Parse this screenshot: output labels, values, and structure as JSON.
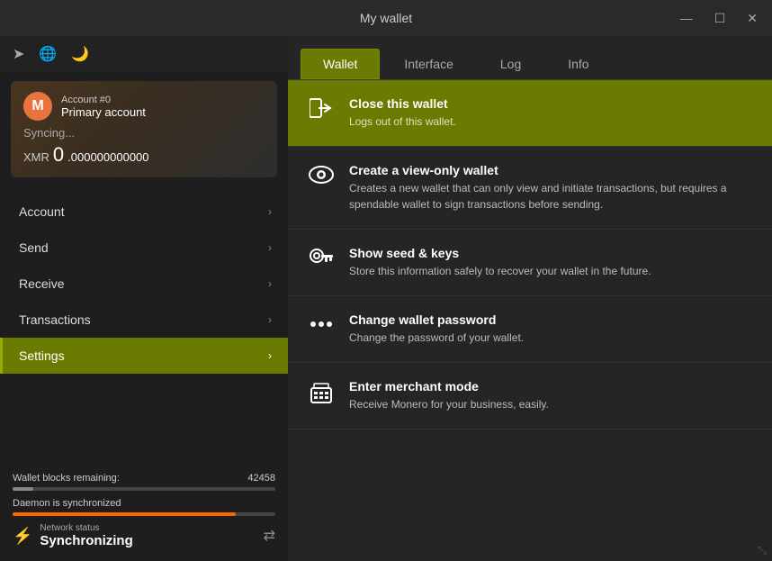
{
  "window": {
    "title": "My wallet",
    "minimize_label": "—",
    "maximize_label": "☐",
    "close_label": "✕"
  },
  "sidebar": {
    "icons": {
      "forward": "➤",
      "globe": "🌐",
      "moon": "🌙"
    },
    "account": {
      "number": "Account #0",
      "name": "Primary account",
      "syncing": "Syncing...",
      "currency": "XMR",
      "balance_whole": "0",
      "balance_decimal": ".000000000000",
      "logo_letter": "M"
    },
    "nav": [
      {
        "id": "account",
        "label": "Account",
        "active": false
      },
      {
        "id": "send",
        "label": "Send",
        "active": false
      },
      {
        "id": "receive",
        "label": "Receive",
        "active": false
      },
      {
        "id": "transactions",
        "label": "Transactions",
        "active": false
      },
      {
        "id": "settings",
        "label": "Settings",
        "active": true
      }
    ],
    "footer": {
      "blocks_label": "Wallet blocks remaining:",
      "blocks_value": "42458",
      "daemon_label": "Daemon is synchronized",
      "network_status_label": "Network status",
      "network_status_value": "Synchronizing"
    }
  },
  "right_panel": {
    "tabs": [
      {
        "id": "wallet",
        "label": "Wallet",
        "active": true
      },
      {
        "id": "interface",
        "label": "Interface",
        "active": false
      },
      {
        "id": "log",
        "label": "Log",
        "active": false
      },
      {
        "id": "info",
        "label": "Info",
        "active": false
      }
    ],
    "settings_items": [
      {
        "id": "close-wallet",
        "icon": "exit",
        "title": "Close this wallet",
        "description": "Logs out of this wallet.",
        "highlighted": true
      },
      {
        "id": "view-only-wallet",
        "icon": "eye",
        "title": "Create a view-only wallet",
        "description": "Creates a new wallet that can only view and initiate transactions, but requires a spendable wallet to sign transactions before sending.",
        "highlighted": false
      },
      {
        "id": "seed-keys",
        "icon": "key",
        "title": "Show seed & keys",
        "description": "Store this information safely to recover your wallet in the future.",
        "highlighted": false
      },
      {
        "id": "change-password",
        "icon": "dots",
        "title": "Change wallet password",
        "description": "Change the password of your wallet.",
        "highlighted": false
      },
      {
        "id": "merchant-mode",
        "icon": "register",
        "title": "Enter merchant mode",
        "description": "Receive Monero for your business, easily.",
        "highlighted": false
      }
    ]
  }
}
